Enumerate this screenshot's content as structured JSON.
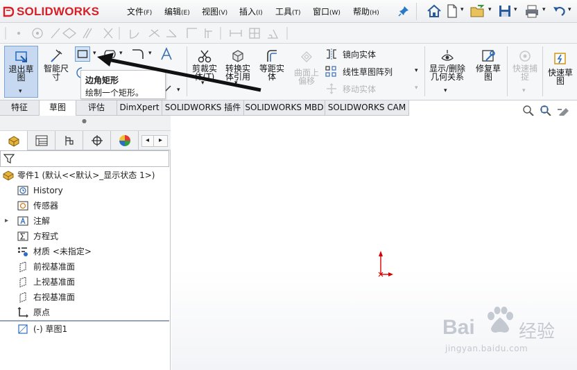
{
  "app": {
    "logo_text": "SOLIDWORKS",
    "menu": [
      {
        "label": "文件",
        "key": "(F)"
      },
      {
        "label": "编辑",
        "key": "(E)"
      },
      {
        "label": "视图",
        "key": "(V)"
      },
      {
        "label": "插入",
        "key": "(I)"
      },
      {
        "label": "工具",
        "key": "(T)"
      },
      {
        "label": "窗口",
        "key": "(W)"
      },
      {
        "label": "帮助",
        "key": "(H)"
      }
    ]
  },
  "ribbon": {
    "exit_sketch": [
      "退出草",
      "图"
    ],
    "smart_dim": [
      "智能尺",
      "寸"
    ],
    "trim": [
      "剪裁实",
      "体(T)"
    ],
    "convert": [
      "转换实",
      "体引用"
    ],
    "offset": [
      "等距实",
      "体"
    ],
    "offset_surface": [
      "曲面上",
      "偏移"
    ],
    "mirror": "镜向实体",
    "linear_pattern": "线性草图阵列",
    "move": "移动实体",
    "display_relations": [
      "显示/删除",
      "几何关系"
    ],
    "repair": [
      "修复草",
      "图"
    ],
    "quick_snap": [
      "快速捕",
      "捉"
    ],
    "rapid_sketch": [
      "快速草",
      "图"
    ]
  },
  "tooltip": {
    "title": "边角矩形",
    "description": "绘制一个矩形。"
  },
  "tabs": [
    "特征",
    "草图",
    "评估",
    "DimXpert",
    "SOLIDWORKS 插件",
    "SOLIDWORKS MBD",
    "SOLIDWORKS CAM"
  ],
  "active_tab": "草图",
  "tree": {
    "root": "零件1 (默认<<默认>_显示状态 1>)",
    "items": [
      "History",
      "传感器",
      "注解",
      "方程式",
      "材质 <未指定>",
      "前视基准面",
      "上视基准面",
      "右视基准面",
      "原点",
      "(-) 草图1"
    ]
  },
  "watermark": {
    "brand": "Bai",
    "brand_cn": "经验",
    "url": "jingyan.baidu.com"
  },
  "colors": {
    "logo_red": "#d61f26",
    "tab_bg": "#e8eaee",
    "origin_red": "#d40000"
  }
}
